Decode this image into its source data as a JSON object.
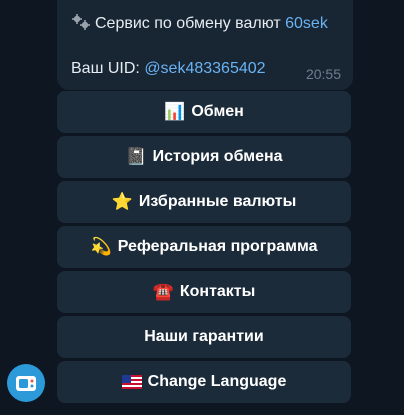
{
  "message": {
    "title_prefix": "Сервис по обмену валют",
    "title_link": "60sek",
    "uid_label": "Ваш UID:",
    "uid_value": "@sek483365402",
    "time": "20:55"
  },
  "keyboard": [
    {
      "emoji": "📊",
      "icon": "bar-chart-icon",
      "label": "Обмен"
    },
    {
      "emoji": "📓",
      "icon": "notebook-icon",
      "label": "История обмена"
    },
    {
      "emoji": "⭐",
      "icon": "star-icon",
      "label": "Избранные валюты"
    },
    {
      "emoji": "💫",
      "icon": "dizzy-star-icon",
      "label": "Реферальная программа"
    },
    {
      "emoji": "☎️",
      "icon": "telephone-icon",
      "label": "Контакты"
    },
    {
      "emoji": "",
      "icon": "",
      "label": "Наши гарантии"
    },
    {
      "emoji": "🇺🇸",
      "icon": "us-flag-icon",
      "label": "Change Language"
    }
  ],
  "colors": {
    "background": "#0e1621",
    "bubble": "#182533",
    "button": "#1c2b3a",
    "link": "#6ab3f3",
    "avatar": "#2c9ad8"
  }
}
